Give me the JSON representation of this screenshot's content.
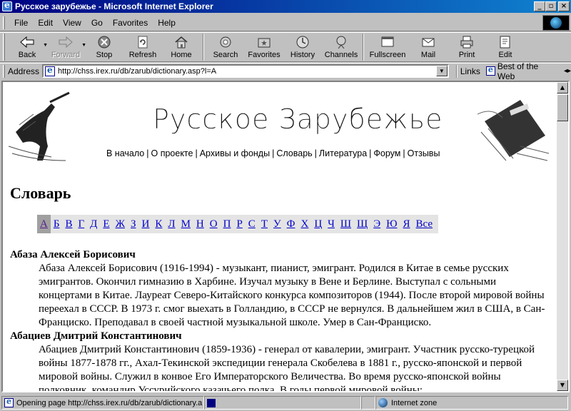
{
  "window": {
    "title": "Русское зарубежье - Microsoft Internet Explorer",
    "controls": [
      "_",
      "▫",
      "×"
    ]
  },
  "menu": {
    "items": [
      "File",
      "Edit",
      "View",
      "Go",
      "Favorites",
      "Help"
    ]
  },
  "toolbar": {
    "back": "Back",
    "forward": "Forward",
    "stop": "Stop",
    "refresh": "Refresh",
    "home": "Home",
    "search": "Search",
    "favorites": "Favorites",
    "history": "History",
    "channels": "Channels",
    "fullscreen": "Fullscreen",
    "mail": "Mail",
    "print": "Print",
    "edit": "Edit"
  },
  "address": {
    "label": "Address",
    "url": "http://chss.irex.ru/db/zarub/dictionary.asp?l=A",
    "links_label": "Links",
    "link_item": "Best of the Web"
  },
  "site": {
    "logo": "Русское Зарубежье",
    "nav": [
      "В начало",
      "О проекте",
      "Архивы и фонды",
      "Словарь",
      "Литература",
      "Форум",
      "Отзывы"
    ],
    "nav_sep": "|",
    "page_title": "Словарь",
    "alphabet": [
      "А",
      "Б",
      "В",
      "Г",
      "Д",
      "Е",
      "Ж",
      "З",
      "И",
      "К",
      "Л",
      "М",
      "Н",
      "О",
      "П",
      "Р",
      "С",
      "Т",
      "У",
      "Ф",
      "Х",
      "Ц",
      "Ч",
      "Ш",
      "Щ",
      "Э",
      "Ю",
      "Я",
      "Все"
    ],
    "active_letter": "А",
    "entries": [
      {
        "title": "Абаза Алексей Борисович",
        "body": "Абаза Алексей Борисович (1916-1994) - музыкант, пианист, эмигрант. Родился в Китае в семье русских эмигрантов. Окончил гимназию в Харбине. Изучал музыку в Вене и Берлине. Выступал с сольными концертами в Китае. Лауреат Северо-Китайского конкурса композиторов (1944). После второй мировой войны переехал в СССР. В 1973 г. смог выехать в Голландию, в СССР не вернулся. В дальнейшем жил в США, в Сан-Франциско. Преподавал в своей частной музыкальной школе. Умер в Сан-Франциско."
      },
      {
        "title": "Абациев Дмитрий Константинович",
        "body": "Абациев Дмитрий Константинович (1859-1936) - генерал от кавалерии, эмигрант. Участник русско-турецкой войны 1877-1878 гг., Ахал-Текинской экспедиции генерала Скобелева в 1881 г., русско-японской и первой мировой войны. Служил в конвое Его Императорского Величества. Во время русско-японской войны полковник, командир Уссурийского казачьего полка. В годы первой мировой войны:"
      }
    ]
  },
  "status": {
    "text": "Opening page http://chss.irex.ru/db/zarub/dictionary.a",
    "zone": "Internet zone"
  }
}
